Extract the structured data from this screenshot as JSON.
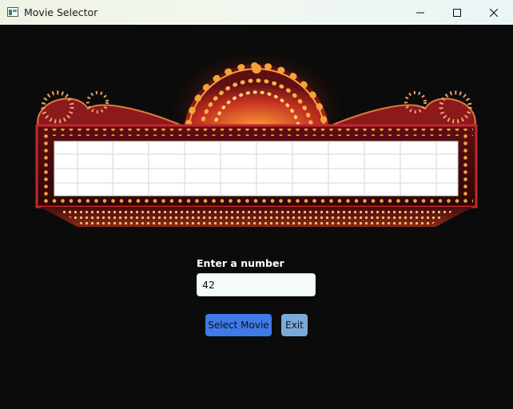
{
  "window": {
    "title": "Movie Selector",
    "app_icon": "window-app-icon",
    "controls": [
      "minimize-icon",
      "maximize-icon",
      "close-icon"
    ]
  },
  "marquee": {
    "image": "theater-marquee-sign",
    "colors": {
      "frame": "#b3222a",
      "bulb": "#f6a23a",
      "glow": "#ff7a1a",
      "board": "#ffffff"
    }
  },
  "form": {
    "prompt_label": "Enter a number",
    "input_value": "42",
    "select_button_label": "Select Movie",
    "exit_button_label": "Exit"
  },
  "colors": {
    "background": "#0b0b0b",
    "primary_button": "#3f7ae6",
    "secondary_button": "#7baad8"
  }
}
